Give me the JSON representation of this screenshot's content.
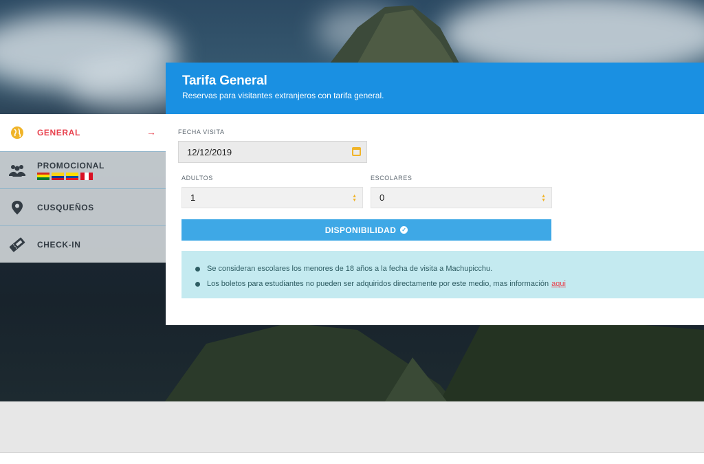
{
  "panel": {
    "title": "Tarifa General",
    "subtitle": "Reservas para visitantes extranjeros con tarifa general."
  },
  "sidebar": {
    "items": [
      {
        "label": "GENERAL",
        "icon": "globe-icon",
        "active": true
      },
      {
        "label": "PROMOCIONAL",
        "icon": "group-icon",
        "active": false
      },
      {
        "label": "CUSQUEÑOS",
        "icon": "location-pin-icon",
        "active": false
      },
      {
        "label": "CHECK-IN",
        "icon": "ticket-icon",
        "active": false
      }
    ],
    "active_arrow": "→"
  },
  "form": {
    "date_label": "FECHA VISITA",
    "date_value": "12/12/2019",
    "adults_label": "ADULTOS",
    "adults_value": "1",
    "students_label": "ESCOLARES",
    "students_value": "0",
    "button_label": "DISPONIBILIDAD"
  },
  "info": {
    "line1": "Se consideran escolares los menores de 18 años a la fecha de visita a Machupicchu.",
    "line2": "Los boletos para estudiantes no pueden ser adquiridos directamente por este medio, mas información",
    "link": "aqui"
  },
  "colors": {
    "header_blue": "#1a90e2",
    "button_blue": "#3ea8e6",
    "accent_red": "#e8434f",
    "accent_yellow": "#f0b429",
    "info_bg": "#c4eaf0"
  }
}
